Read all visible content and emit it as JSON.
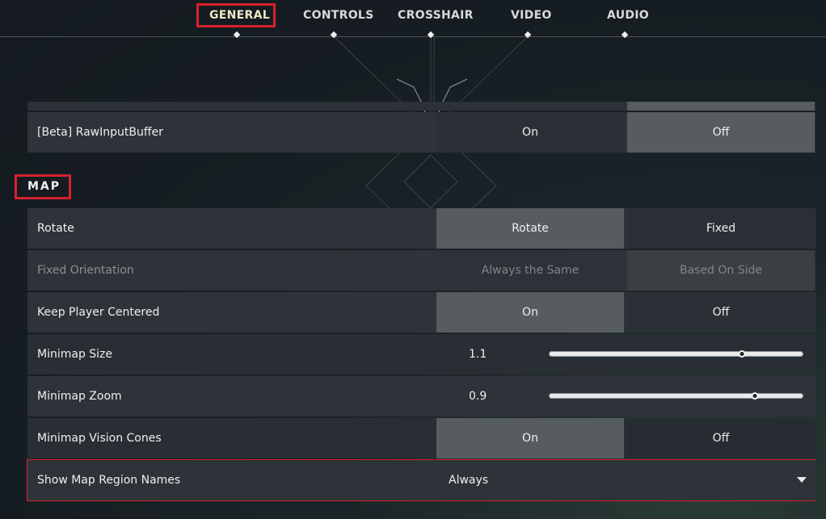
{
  "nav": {
    "tabs": [
      {
        "label": "GENERAL",
        "active": true
      },
      {
        "label": "CONTROLS",
        "active": false
      },
      {
        "label": "CROSSHAIR",
        "active": false
      },
      {
        "label": "VIDEO",
        "active": false
      },
      {
        "label": "AUDIO",
        "active": false
      }
    ]
  },
  "colors": {
    "highlight": "#d7212e",
    "selected_option_bg": "#575c61",
    "row_bg": "#2d3338"
  },
  "settings": {
    "raw_input_buffer": {
      "label": "[Beta] RawInputBuffer",
      "option_a": "On",
      "option_b": "Off",
      "selected": "Off"
    }
  },
  "map": {
    "title": "MAP",
    "rotate": {
      "label": "Rotate",
      "option_a": "Rotate",
      "option_b": "Fixed",
      "selected": "Rotate"
    },
    "fixed_orientation": {
      "label": "Fixed Orientation",
      "option_a": "Always the Same",
      "option_b": "Based On Side",
      "selected": "Based On Side",
      "disabled": true
    },
    "keep_player_centered": {
      "label": "Keep Player Centered",
      "option_a": "On",
      "option_b": "Off",
      "selected": "On"
    },
    "minimap_size": {
      "label": "Minimap Size",
      "value": "1.1",
      "slider_fraction": 0.76
    },
    "minimap_zoom": {
      "label": "Minimap Zoom",
      "value": "0.9",
      "slider_fraction": 0.81
    },
    "minimap_vision_cones": {
      "label": "Minimap Vision Cones",
      "option_a": "On",
      "option_b": "Off",
      "selected": "On"
    },
    "show_map_region_names": {
      "label": "Show Map Region Names",
      "value": "Always"
    }
  }
}
